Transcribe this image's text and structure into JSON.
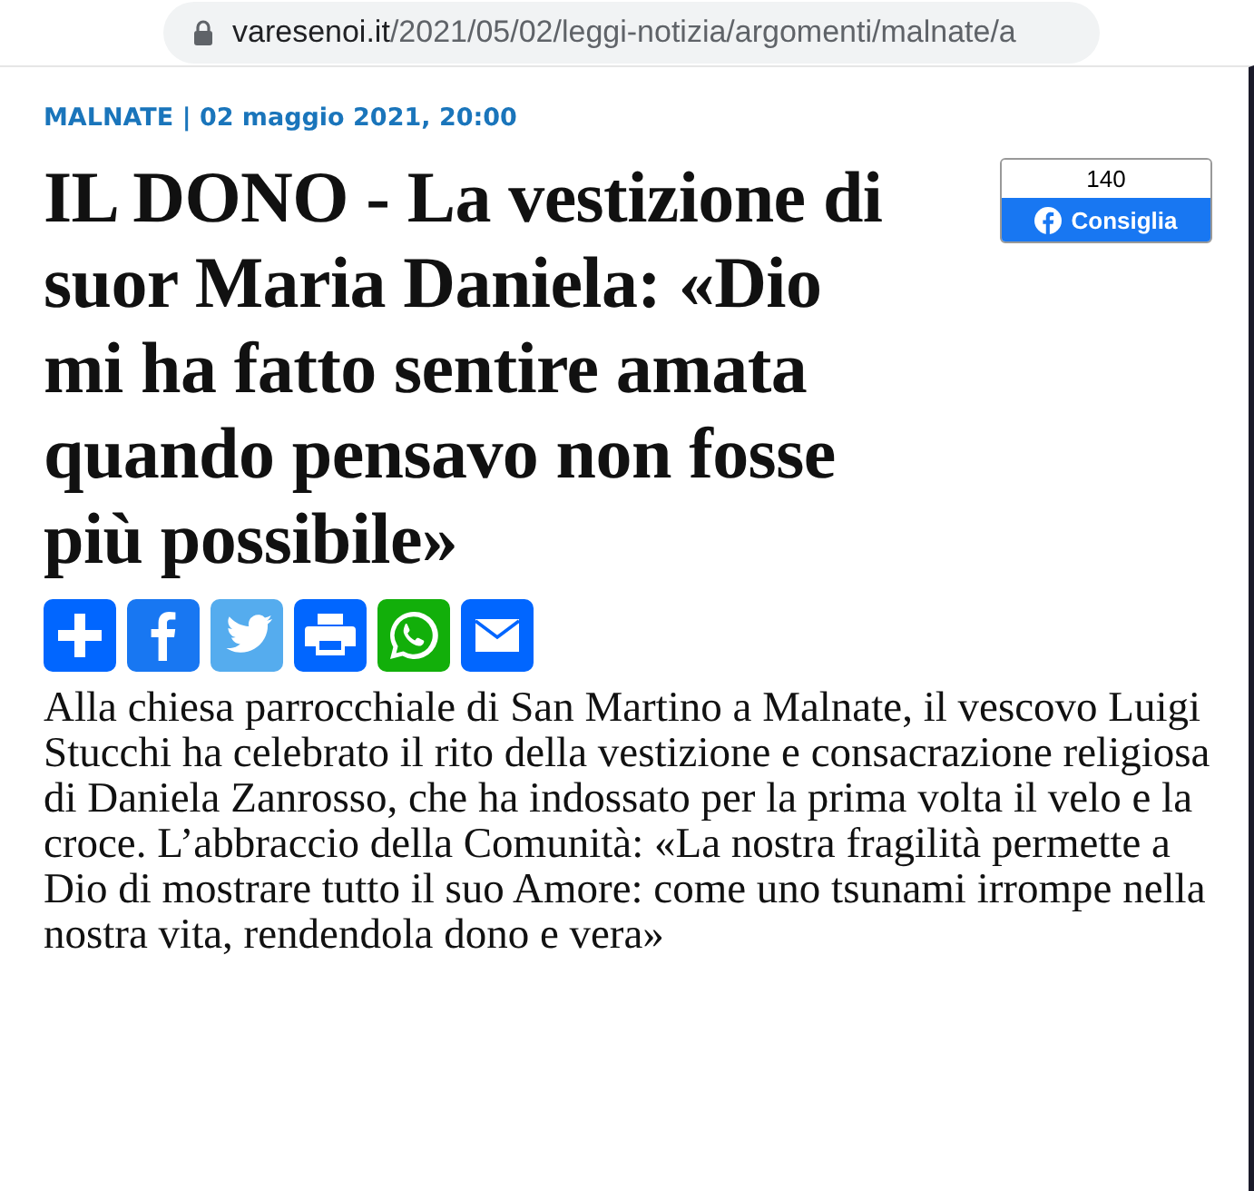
{
  "address_bar": {
    "domain": "varesenoi.it",
    "path": "/2021/05/02/leggi-notizia/argomenti/malnate/a"
  },
  "article": {
    "kicker": "MALNATE | 02 maggio 2021, 20:00",
    "title": "IL DONO - La vestizione di suor Maria Daniela: «Dio mi ha fatto sentire amata quando pensavo non fosse più possibile»",
    "like_box": {
      "count": "140",
      "label": "Consiglia"
    },
    "share_buttons": [
      {
        "kind": "plus",
        "color": "#0166ff"
      },
      {
        "kind": "facebook",
        "color": "#1877f2"
      },
      {
        "kind": "twitter",
        "color": "#55acee"
      },
      {
        "kind": "print",
        "color": "#0166ff"
      },
      {
        "kind": "whatsapp",
        "color": "#12af0a"
      },
      {
        "kind": "email",
        "color": "#0166ff"
      }
    ],
    "summary": "Alla chiesa parrocchiale di San Martino a Malnate, il vescovo Luigi Stucchi ha celebrato il rito della vestizione e consacrazione religiosa di Daniela Zanrosso, che ha indossato per la prima volta il velo e la croce. L’abbraccio della Comunità: «La nostra fragilità permette a Dio di mostrare tutto il suo Amore: come uno tsunami irrompe nella nostra vita, rendendola dono e vera»"
  }
}
